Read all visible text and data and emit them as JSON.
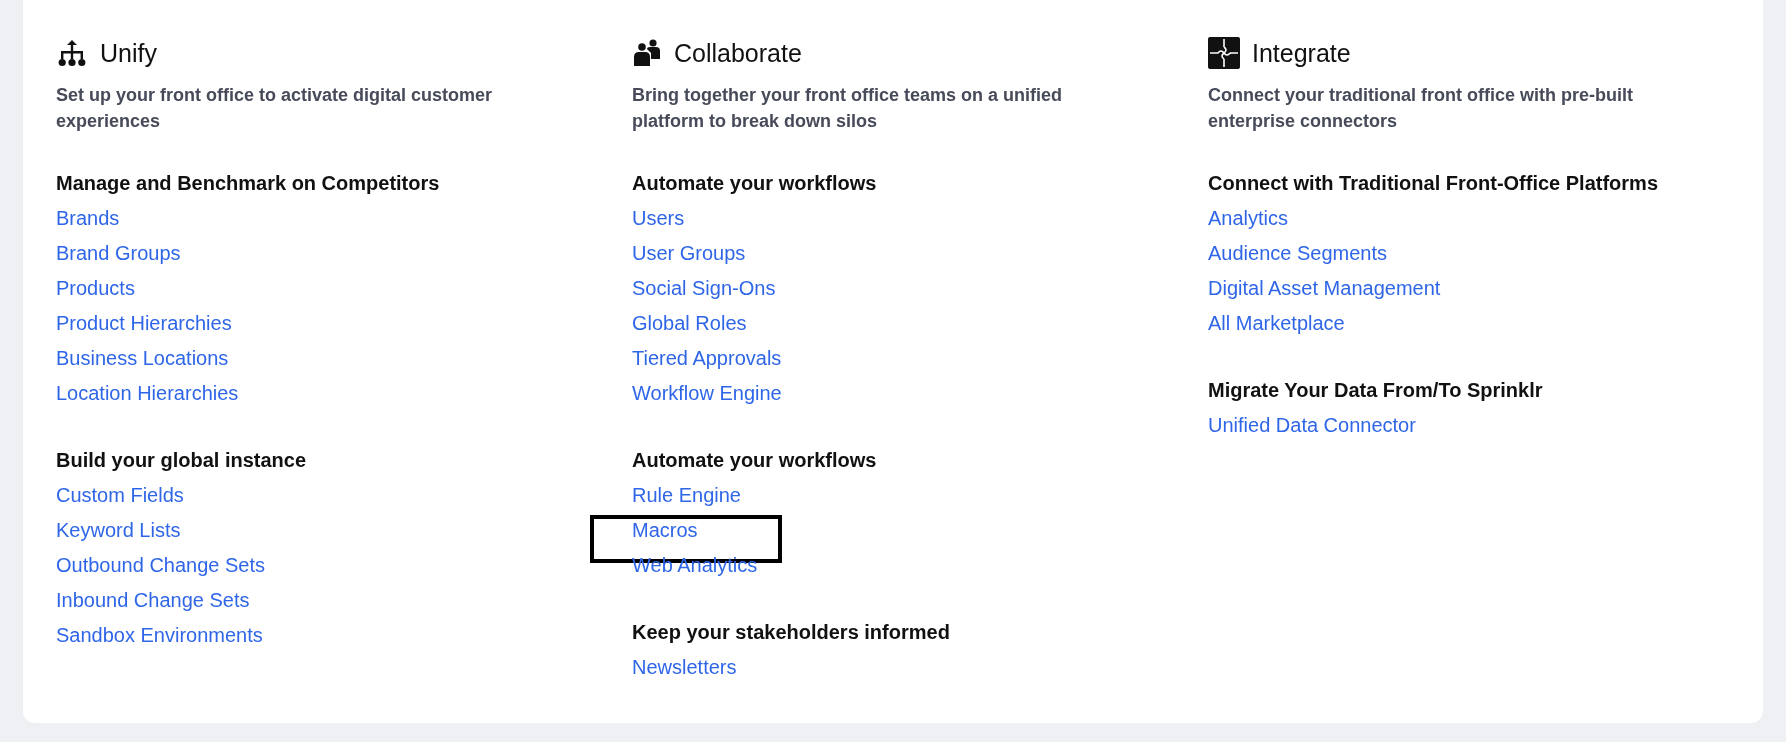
{
  "columns": [
    {
      "title": "Unify",
      "description": "Set up your front office to activate digital customer experiences",
      "sections": [
        {
          "heading": "Manage and Benchmark on Competitors",
          "links": [
            {
              "label": "Brands",
              "highlighted": false
            },
            {
              "label": "Brand Groups",
              "highlighted": false
            },
            {
              "label": "Products",
              "highlighted": false
            },
            {
              "label": "Product Hierarchies",
              "highlighted": false
            },
            {
              "label": "Business Locations",
              "highlighted": false
            },
            {
              "label": "Location Hierarchies",
              "highlighted": false
            }
          ]
        },
        {
          "heading": "Build your global instance",
          "links": [
            {
              "label": "Custom Fields",
              "highlighted": false
            },
            {
              "label": "Keyword Lists",
              "highlighted": false
            },
            {
              "label": "Outbound Change Sets",
              "highlighted": false
            },
            {
              "label": "Inbound Change Sets",
              "highlighted": false
            },
            {
              "label": "Sandbox Environments",
              "highlighted": false
            }
          ]
        }
      ]
    },
    {
      "title": "Collaborate",
      "description": "Bring together your front office teams on a unified platform to break down silos",
      "sections": [
        {
          "heading": "Automate your workflows",
          "links": [
            {
              "label": "Users",
              "highlighted": false
            },
            {
              "label": "User Groups",
              "highlighted": false
            },
            {
              "label": "Social Sign-Ons",
              "highlighted": false
            },
            {
              "label": "Global Roles",
              "highlighted": false
            },
            {
              "label": "Tiered Approvals",
              "highlighted": false
            },
            {
              "label": "Workflow Engine",
              "highlighted": false
            }
          ]
        },
        {
          "heading": "Automate your workflows",
          "links": [
            {
              "label": "Rule Engine",
              "highlighted": false
            },
            {
              "label": "Macros",
              "highlighted": true
            },
            {
              "label": "Web Analytics",
              "highlighted": false
            }
          ]
        },
        {
          "heading": "Keep your stakeholders informed",
          "links": [
            {
              "label": "Newsletters",
              "highlighted": false
            }
          ]
        }
      ]
    },
    {
      "title": "Integrate",
      "description": "Connect your traditional front office with pre-built enterprise connectors",
      "sections": [
        {
          "heading": "Connect with Traditional Front-Office Platforms",
          "links": [
            {
              "label": "Analytics",
              "highlighted": false
            },
            {
              "label": "Audience Segments",
              "highlighted": false
            },
            {
              "label": "Digital Asset Management",
              "highlighted": false
            },
            {
              "label": "All Marketplace",
              "highlighted": false
            }
          ]
        },
        {
          "heading": "Migrate Your Data From/To Sprinklr",
          "links": [
            {
              "label": "Unified Data Connector",
              "highlighted": false
            }
          ]
        }
      ]
    }
  ]
}
